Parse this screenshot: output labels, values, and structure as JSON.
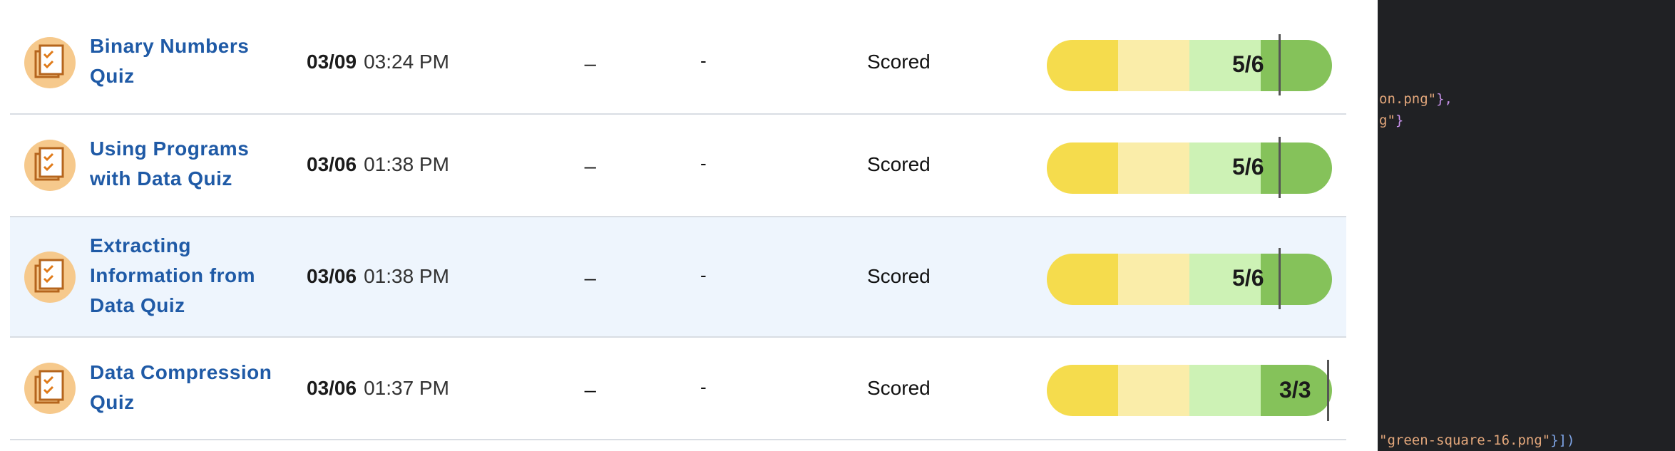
{
  "quizzes": [
    {
      "title": "Binary Numbers Quiz",
      "title_lines": [
        "Binary Numbers",
        "Quiz"
      ],
      "date": "03/09",
      "time": "03:24 PM",
      "col3": "_",
      "col4": "-",
      "status": "Scored",
      "score": "5/6",
      "fraction": 0.8333
    },
    {
      "title": "Using Programs with Data Quiz",
      "title_lines": [
        "Using Programs",
        "with Data Quiz"
      ],
      "date": "03/06",
      "time": "01:38 PM",
      "col3": "_",
      "col4": "-",
      "status": "Scored",
      "score": "5/6",
      "fraction": 0.8333
    },
    {
      "title": "Extracting Information from Data Quiz",
      "title_lines": [
        "Extracting",
        "Information from",
        "Data Quiz"
      ],
      "date": "03/06",
      "time": "01:38 PM",
      "col3": "_",
      "col4": "-",
      "status": "Scored",
      "score": "5/6",
      "fraction": 0.8333,
      "highlighted": true
    },
    {
      "title": "Data Compression Quiz",
      "title_lines": [
        "Data Compression",
        "Quiz"
      ],
      "date": "03/06",
      "time": "01:37 PM",
      "col3": "_",
      "col4": "-",
      "status": "Scored",
      "score": "3/3",
      "fraction": 1.0
    }
  ],
  "colors": {
    "title": "#1f5aa6",
    "highlight_row": "#eef5fd",
    "bar_segments": [
      "#f5dc4d",
      "#faeda9",
      "#cdf2b5",
      "#85c25a"
    ],
    "icon_bg": "#f6c98c",
    "editor_bg": "#202124"
  },
  "icons": {
    "quiz": "checklist-icon"
  },
  "editor": {
    "line1_str": "on.png\"",
    "line1_punct": "},",
    "line2_str": "g\"",
    "line2_punct": "}",
    "line3_str": "\"green-square-16.png\"",
    "line3_punct": "}])"
  }
}
